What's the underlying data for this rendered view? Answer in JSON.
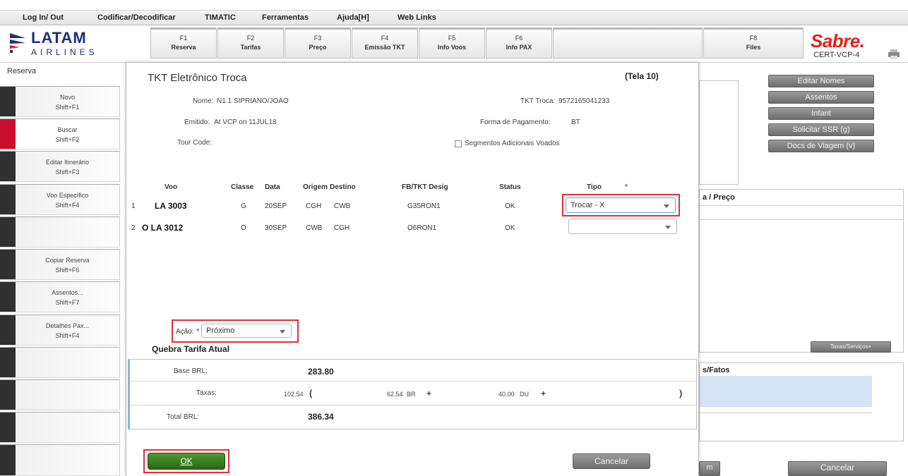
{
  "menu": [
    {
      "label": "Log In/ Out"
    },
    {
      "label": "Codificar/Decodificar"
    },
    {
      "label": "TIMATIC"
    },
    {
      "label": "Ferramentas"
    },
    {
      "label": "Ajuda[H]"
    },
    {
      "label": "Web Links"
    }
  ],
  "brand": {
    "latam": "LATAM",
    "airlines": "AIRLINES",
    "sabre": "Sabre.",
    "station": "CERT-VCP-4",
    "latam_color": "#1d2f7d",
    "sabre_color": "#e2231a"
  },
  "fkeys": [
    {
      "key": "F1",
      "label": "Reserva"
    },
    {
      "key": "F2",
      "label": "Tarifas"
    },
    {
      "key": "F3",
      "label": "Preço"
    },
    {
      "key": "F4",
      "label": "Emissão TKT"
    },
    {
      "key": "F5",
      "label": "Info Voos"
    },
    {
      "key": "F6",
      "label": "Info PAX"
    },
    {
      "key": "",
      "label": ""
    },
    {
      "key": "F8",
      "label": "Files"
    }
  ],
  "sidebar": {
    "title": "Reserva",
    "items": [
      {
        "label": "Novo",
        "shortcut": "Shift+F1"
      },
      {
        "label": "Buscar",
        "shortcut": "Shift+F2"
      },
      {
        "label": "Editar Itinerário",
        "shortcut": "Shift+F3"
      },
      {
        "label": "Voo Específico",
        "shortcut": "Shift+F4"
      },
      {
        "label": "",
        "shortcut": ""
      },
      {
        "label": "Copiar Reserva",
        "shortcut": "Shift+F6"
      },
      {
        "label": "Assentos...",
        "shortcut": "Shift+F7"
      },
      {
        "label": "Detalhes Pax...",
        "shortcut": "Shift+F4"
      }
    ]
  },
  "right_panel": {
    "buttons": [
      "Editar Nomes",
      "Assentos",
      "Infant",
      "Solicitar SSR (g)",
      "Docs de Viagem (v)"
    ],
    "section_preco": "a / Preço",
    "section_fatos": "s/Fatos",
    "taxes_button": "Taxas/Serviços+",
    "partial_button": "m",
    "cancel_button": "Cancelar"
  },
  "dialog": {
    "title": "TKT Eletrônico Troca",
    "screen": "(Tela 10)",
    "nome_label": "Nome:",
    "nome_value": "N1.1 SIPRIANO/JOAO",
    "emitido_label": "Emitido:",
    "emitido_value": "At VCP on 11JUL18",
    "tour_label": "Tour Code:",
    "tkt_troca_label": "TKT Troca:",
    "tkt_troca_value": "9572165041233",
    "forma_label": "Forma de Pagamento:",
    "forma_value": "BT",
    "segmentos_label": "Segmentos Adicionais Voados",
    "columns": {
      "voo": "Voo",
      "classe": "Classe",
      "data": "Data",
      "origem": "Origem",
      "destino": "Destino",
      "fbtkt": "FB/TKT Desig",
      "status": "Status",
      "tipo": "Tipo",
      "tipo_required": "*"
    },
    "rows": [
      {
        "num": "1",
        "voo": "LA 3003",
        "classe": "G",
        "data": "20SEP",
        "origem": "CGH",
        "destino": "CWB",
        "fb": "G35RON1",
        "status": "OK",
        "tipo": "Trocar - X"
      },
      {
        "num": "2",
        "voo": "O LA 3012",
        "classe": "O",
        "data": "30SEP",
        "origem": "CWB",
        "destino": "CGH",
        "fb": "O6RON1",
        "status": "OK",
        "tipo": ""
      }
    ],
    "acao_label": "Ação:",
    "acao_required": "*",
    "acao_value": "Próximo",
    "fare_title": "Quebra Tarifa Atual",
    "base_label": "Base BRL:",
    "base_value": "283.80",
    "taxas_label": "Taxas:",
    "taxas_total": "102.54",
    "tax1_amount": "62.54",
    "tax1_code": "BR",
    "tax2_amount": "40.00",
    "tax2_code": "DU",
    "paren_open": "(",
    "paren_close": ")",
    "plus": "+",
    "total_label": "Total BRL:",
    "total_value": "386.34",
    "ok_button": "OK",
    "cancel_button": "Cancelar"
  }
}
